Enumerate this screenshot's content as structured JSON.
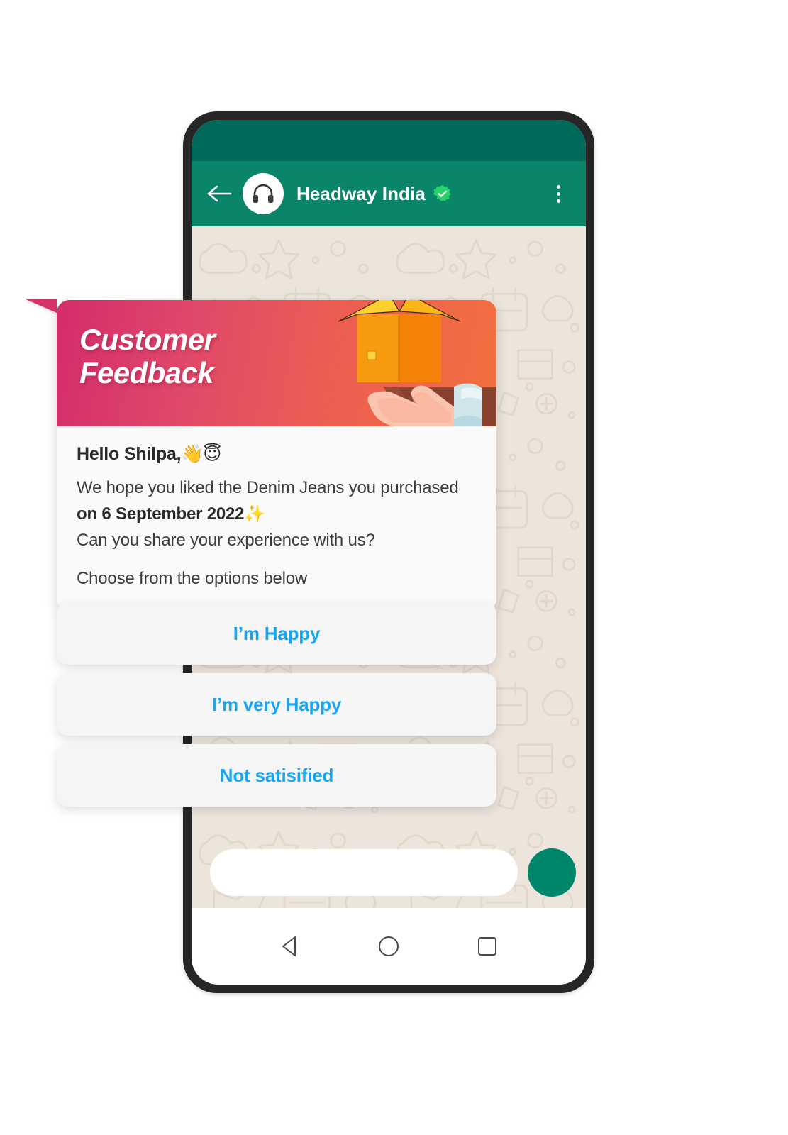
{
  "app": {
    "platform": "whatsapp",
    "header": {
      "back_icon": "back-arrow-icon",
      "avatar_icon": "headphones-icon",
      "contact_name": "Headway India",
      "verified_icon": "verified-badge-icon",
      "menu_icon": "kebab-menu-icon",
      "bar_color": "#0A8569",
      "status_bar_color": "#00695A",
      "verified_color": "#25D366"
    },
    "chat": {
      "wallpaper_color": "#EDE5DC",
      "doodle_color": "#DDD2C6"
    },
    "composer": {
      "input_value": "",
      "input_placeholder": "",
      "send_icon": "send-button-icon",
      "send_color": "#00866B"
    },
    "navbar": {
      "back_icon": "nav-back-triangle-icon",
      "home_icon": "nav-home-circle-icon",
      "recents_icon": "nav-recents-square-icon"
    }
  },
  "feedback_card": {
    "banner": {
      "title": "Customer\nFeedback",
      "gradient_from": "#D32C6B",
      "gradient_to": "#F2703E",
      "illustration": "hand-holding-open-box-icon"
    },
    "greeting": "Hello Shilpa,",
    "greeting_emojis": "👋😇",
    "body_line_1_pre": "We hope you liked the Denim Jeans you purchased ",
    "body_line_1_bold": "on 6 September 2022",
    "body_line_1_emoji": "✨",
    "body_line_2": "Can you share your experience with us?",
    "body_line_3": "Choose from the options below",
    "text_color": "#3C3C3C",
    "card_bg": "#FAFAFA"
  },
  "reply_options": {
    "accent_color": "#17A6F0",
    "items": [
      {
        "label": "I’m Happy"
      },
      {
        "label": "I’m very Happy"
      },
      {
        "label": "Not satisified"
      }
    ]
  }
}
